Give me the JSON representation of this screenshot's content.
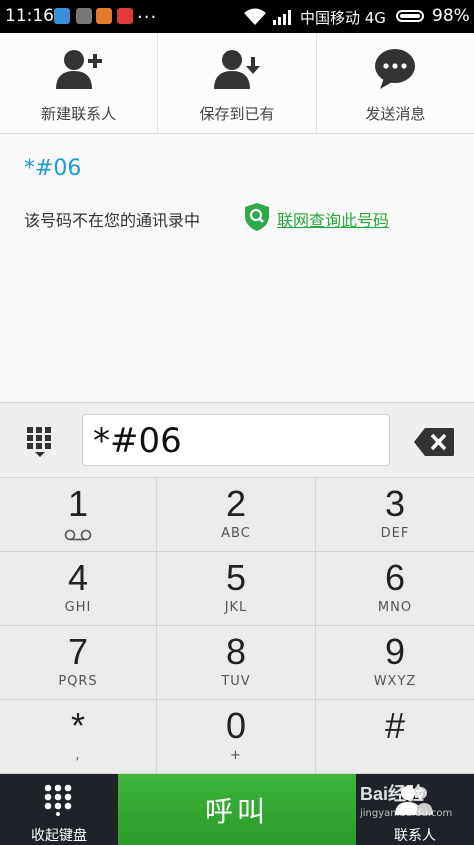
{
  "status_bar": {
    "time": "11:16",
    "dots": "...",
    "carrier": "中国移动 4G",
    "battery": "98%",
    "battery_level": 0.98,
    "notification_icons": [
      "weibo-icon",
      "photo-icon",
      "compass-icon",
      "alarm-icon"
    ]
  },
  "actions": [
    {
      "label": "新建联系人",
      "icon": "add-contact-icon"
    },
    {
      "label": "保存到已有",
      "icon": "save-contact-icon"
    },
    {
      "label": "发送消息",
      "icon": "message-icon"
    }
  ],
  "info": {
    "number": "*#06",
    "not_in_contacts": "该号码不在您的通讯录中",
    "lookup_link": "联网查询此号码",
    "lookup_icon": "shield-search-icon"
  },
  "input": {
    "value": "*#06"
  },
  "keypad": [
    {
      "digit": "1",
      "letters": ""
    },
    {
      "digit": "2",
      "letters": "ABC"
    },
    {
      "digit": "3",
      "letters": "DEF"
    },
    {
      "digit": "4",
      "letters": "GHI"
    },
    {
      "digit": "5",
      "letters": "JKL"
    },
    {
      "digit": "6",
      "letters": "MNO"
    },
    {
      "digit": "7",
      "letters": "PQRS"
    },
    {
      "digit": "8",
      "letters": "TUV"
    },
    {
      "digit": "9",
      "letters": "WXYZ"
    },
    {
      "digit": "*",
      "letters": ","
    },
    {
      "digit": "0",
      "letters": "+"
    },
    {
      "digit": "#",
      "letters": ""
    }
  ],
  "bottom_bar": {
    "collapse_label": "收起键盘",
    "call_label": "呼叫",
    "contacts_label": "联系人"
  },
  "watermark": {
    "text": "Bai经验",
    "sub": "jingyan.baidu.com"
  },
  "colors": {
    "accent_blue": "#1d9ad4",
    "link_green": "#27a83a",
    "call_green": "#35a832",
    "bottom_dark": "#1f2329"
  }
}
